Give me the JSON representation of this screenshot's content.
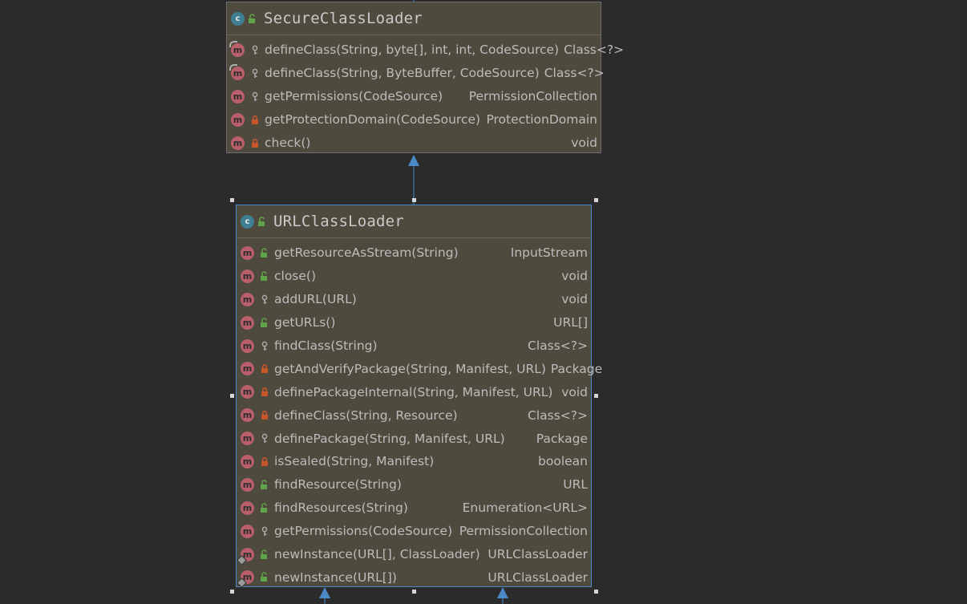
{
  "icons": {
    "class": "class-icon",
    "method": "method-icon",
    "public": "lock-open-icon",
    "protected": "key-icon",
    "private": "lock-icon"
  },
  "colors": {
    "background": "#2b2b2b",
    "node_fill": "#4f4a3e",
    "selection": "#4a88c7",
    "class_badge": "#3f7f93",
    "method_badge": "#b85f6a",
    "public": "#5fa34a",
    "private": "#c7562b"
  },
  "nodes": [
    {
      "id": "secure",
      "badge": "c",
      "title": "SecureClassLoader",
      "methods": [
        {
          "badge": "m",
          "overlay": "top",
          "vis": "protected",
          "name": "defineClass(String, byte[], int, int, CodeSource)",
          "type": "Class<?>"
        },
        {
          "badge": "m",
          "overlay": "top",
          "vis": "protected",
          "name": "defineClass(String, ByteBuffer, CodeSource)",
          "type": "Class<?>"
        },
        {
          "badge": "m",
          "overlay": "",
          "vis": "protected",
          "name": "getPermissions(CodeSource)",
          "type": "PermissionCollection"
        },
        {
          "badge": "m",
          "overlay": "",
          "vis": "private",
          "name": "getProtectionDomain(CodeSource)",
          "type": "ProtectionDomain"
        },
        {
          "badge": "m",
          "overlay": "",
          "vis": "private",
          "name": "check()",
          "type": "void"
        }
      ]
    },
    {
      "id": "url",
      "badge": "c",
      "title": "URLClassLoader",
      "methods": [
        {
          "badge": "m",
          "overlay": "",
          "vis": "public",
          "name": "getResourceAsStream(String)",
          "type": "InputStream"
        },
        {
          "badge": "m",
          "overlay": "",
          "vis": "public",
          "name": "close()",
          "type": "void"
        },
        {
          "badge": "m",
          "overlay": "",
          "vis": "protected",
          "name": "addURL(URL)",
          "type": "void"
        },
        {
          "badge": "m",
          "overlay": "",
          "vis": "public",
          "name": "getURLs()",
          "type": "URL[]"
        },
        {
          "badge": "m",
          "overlay": "",
          "vis": "protected",
          "name": "findClass(String)",
          "type": "Class<?>"
        },
        {
          "badge": "m",
          "overlay": "",
          "vis": "private",
          "name": "getAndVerifyPackage(String, Manifest, URL)",
          "type": "Package"
        },
        {
          "badge": "m",
          "overlay": "",
          "vis": "private",
          "name": "definePackageInternal(String, Manifest, URL)",
          "type": "void"
        },
        {
          "badge": "m",
          "overlay": "",
          "vis": "private",
          "name": "defineClass(String, Resource)",
          "type": "Class<?>"
        },
        {
          "badge": "m",
          "overlay": "",
          "vis": "protected",
          "name": "definePackage(String, Manifest, URL)",
          "type": "Package"
        },
        {
          "badge": "m",
          "overlay": "",
          "vis": "private",
          "name": "isSealed(String, Manifest)",
          "type": "boolean"
        },
        {
          "badge": "m",
          "overlay": "",
          "vis": "public",
          "name": "findResource(String)",
          "type": "URL"
        },
        {
          "badge": "m",
          "overlay": "",
          "vis": "public",
          "name": "findResources(String)",
          "type": "Enumeration<URL>"
        },
        {
          "badge": "m",
          "overlay": "",
          "vis": "protected",
          "name": "getPermissions(CodeSource)",
          "type": "PermissionCollection"
        },
        {
          "badge": "m",
          "overlay": "static",
          "vis": "public",
          "name": "newInstance(URL[], ClassLoader)",
          "type": "URLClassLoader"
        },
        {
          "badge": "m",
          "overlay": "static",
          "vis": "public",
          "name": "newInstance(URL[])",
          "type": "URLClassLoader"
        }
      ]
    }
  ]
}
